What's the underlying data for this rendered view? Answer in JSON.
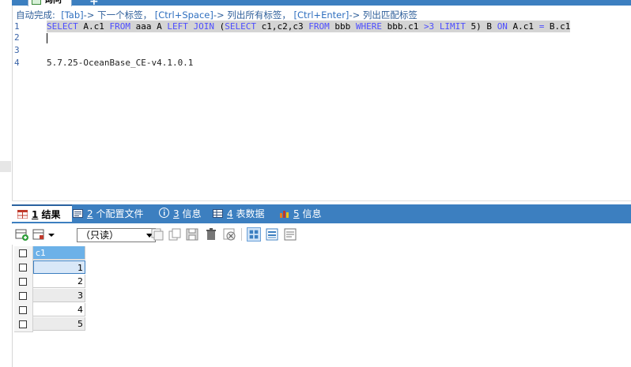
{
  "query_tab": {
    "label": "询问",
    "add_label": "+"
  },
  "hint": {
    "prefix": "自动完成:",
    "items": [
      {
        "key": "[Tab]",
        "text": "-> 下一个标签，"
      },
      {
        "key": "[Ctrl+Space]",
        "text": "-> 列出所有标签，"
      },
      {
        "key": "[Ctrl+Enter]",
        "text": "-> 列出匹配标签"
      }
    ]
  },
  "editor": {
    "line_numbers": [
      "1",
      "2",
      "3",
      "4"
    ],
    "line1": [
      {
        "t": "SELECT",
        "kw": true
      },
      {
        "t": " A.c1 ",
        "kw": false
      },
      {
        "t": "FROM",
        "kw": true
      },
      {
        "t": " aaa A ",
        "kw": false
      },
      {
        "t": "LEFT JOIN",
        "kw": true
      },
      {
        "t": " (",
        "kw": false
      },
      {
        "t": "SELECT",
        "kw": true
      },
      {
        "t": " c1,c2,c3 ",
        "kw": false
      },
      {
        "t": "FROM",
        "kw": true
      },
      {
        "t": " bbb ",
        "kw": false
      },
      {
        "t": "WHERE",
        "kw": true
      },
      {
        "t": " bbb.c1 ",
        "kw": false
      },
      {
        "t": ">3 ",
        "kw": true
      },
      {
        "t": "",
        "kw": false
      },
      {
        "t": "LIMIT",
        "kw": true
      },
      {
        "t": " 5) B ",
        "kw": false
      },
      {
        "t": "ON",
        "kw": true
      },
      {
        "t": " A.c1 ",
        "kw": false
      },
      {
        "t": "=",
        "kw": true
      },
      {
        "t": " B.c1",
        "kw": false
      }
    ],
    "line4": "5.7.25-OceanBase_CE-v4.1.0.1"
  },
  "result_tabs": [
    {
      "num": "1",
      "label": " 结果",
      "icon": "grid-result-icon"
    },
    {
      "num": "2",
      "label": " 个配置文件",
      "icon": "profile-icon"
    },
    {
      "num": "3",
      "label": " 信息",
      "icon": "info-icon"
    },
    {
      "num": "4",
      "label": " 表数据",
      "icon": "table-data-icon"
    },
    {
      "num": "5",
      "label": " 信息",
      "icon": "info-chart-icon"
    }
  ],
  "toolbar": {
    "mode_select": "（只读）"
  },
  "grid": {
    "columns": [
      "c1"
    ],
    "rows": [
      "1",
      "2",
      "3",
      "4",
      "5"
    ]
  },
  "colors": {
    "accent": "#3c7fc0",
    "keyword": "#4d4dff",
    "header_cell": "#6cb1e8"
  }
}
